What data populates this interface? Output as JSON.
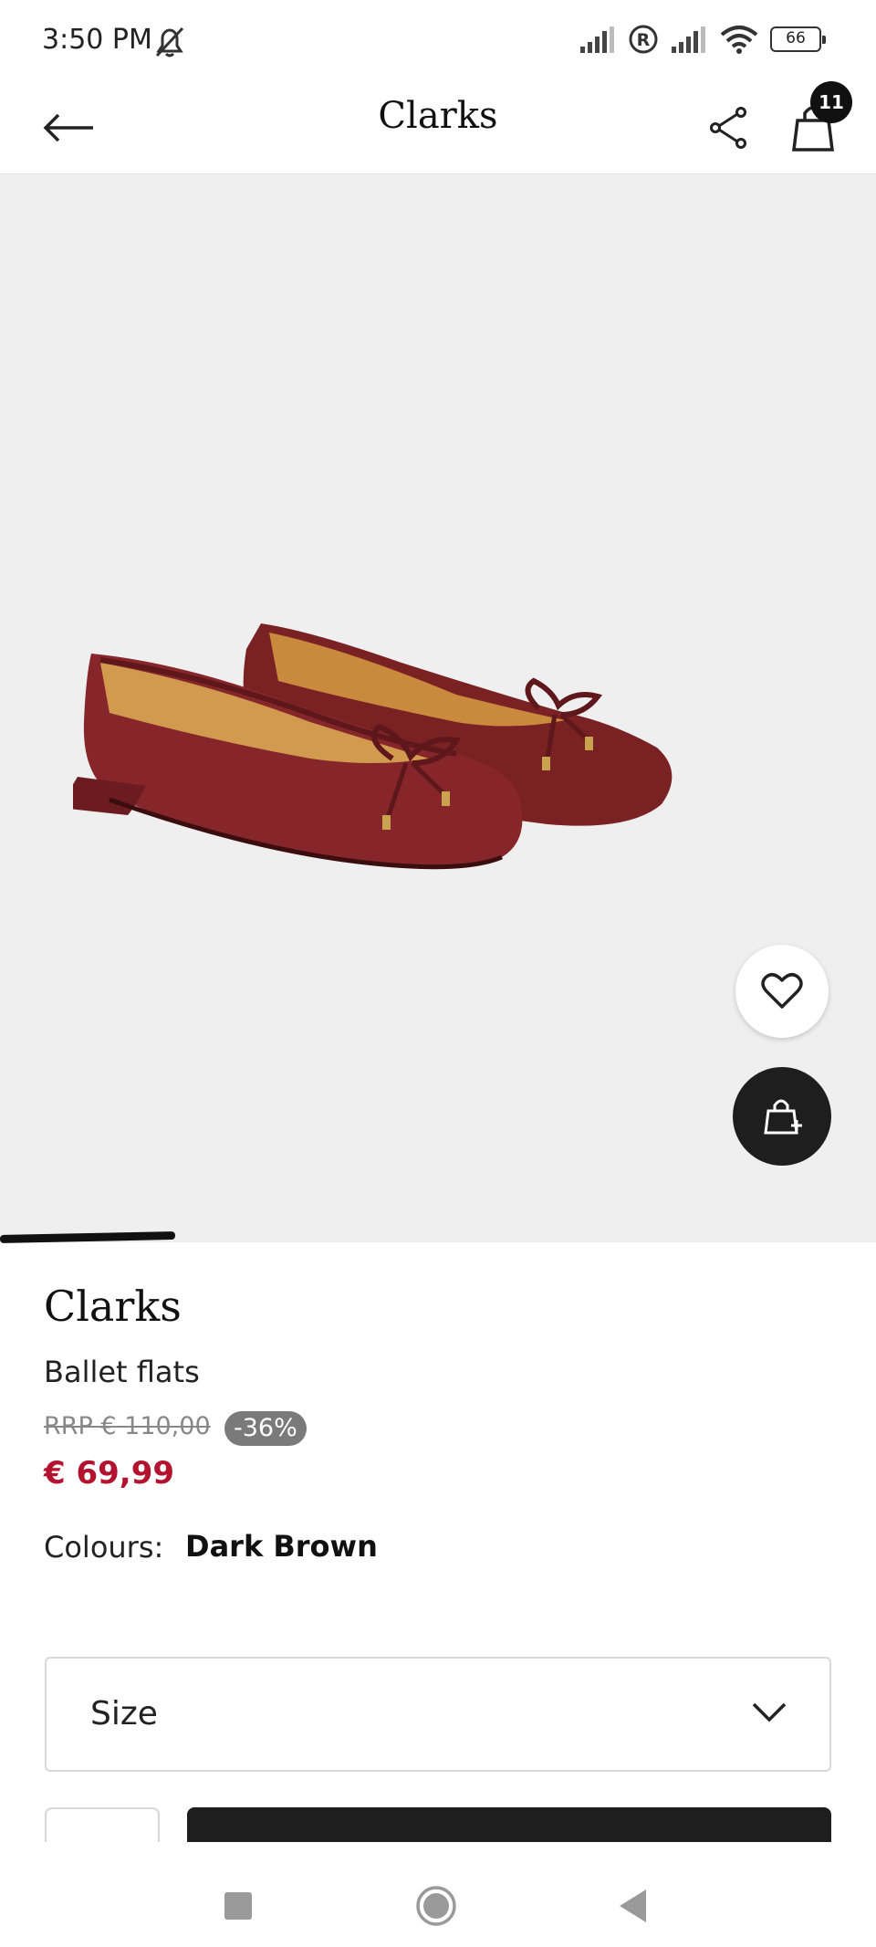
{
  "status_bar": {
    "time": "3:50 PM",
    "battery": "66",
    "icons": [
      "dnd-off-icon",
      "signal-icon",
      "registered-icon",
      "signal-icon",
      "wifi-icon",
      "battery-icon"
    ]
  },
  "header": {
    "title": "Clarks",
    "cart_count": "11",
    "icons": [
      "arrow-left-icon",
      "share-icon",
      "shopping-bag-icon"
    ]
  },
  "gallery": {
    "image": "dark-red-leather-ballet-flats-with-bow",
    "progress": 0.2,
    "icons": [
      "heart-icon",
      "bag-plus-icon"
    ]
  },
  "product": {
    "brand": "Clarks",
    "name": "Ballet flats",
    "rrp": "RRP € 110,00",
    "discount": "-36%",
    "price": "€ 69,99",
    "colours_label": "Colours:",
    "colour": "Dark Brown"
  },
  "size_selector": {
    "label": "Size",
    "icon": "chevron-down-icon"
  },
  "colors": {
    "price": "#b4132f",
    "shoe": "#7e2325",
    "badge": "#7a7a7a",
    "dark": "#1e1e1e"
  },
  "nav_bar": {
    "icons": [
      "recent-apps-icon",
      "home-icon",
      "back-triangle-icon"
    ]
  }
}
